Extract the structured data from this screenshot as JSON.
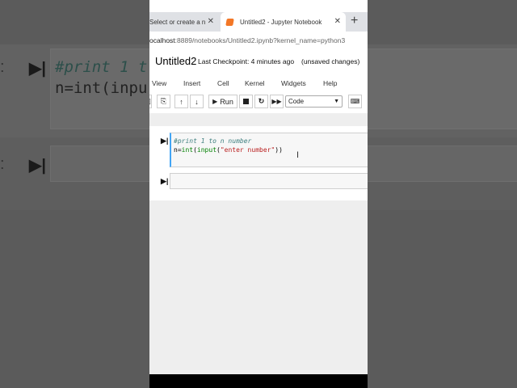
{
  "background": {
    "line1": "#print 1 t",
    "line2": "n=int(inpu",
    "colon": ":"
  },
  "tabs": {
    "inactive_label": "Select or create a n",
    "active_label": "Untitled2 - Jupyter Notebook",
    "new_tab": "+"
  },
  "address": {
    "host": "ocalhost",
    "rest": ":8889/notebooks/Untitled2.ipynb?kernel_name=python3"
  },
  "notebook": {
    "title": "Untitled2",
    "checkpoint": "Last Checkpoint: 4 minutes ago",
    "unsaved": "(unsaved changes)"
  },
  "menu": [
    "View",
    "Insert",
    "Cell",
    "Kernel",
    "Widgets",
    "Help"
  ],
  "toolbar": {
    "run_label": "Run",
    "cell_type": "Code"
  },
  "cells": [
    {
      "comment": "#print 1 to n number",
      "code_prefix": "n=",
      "code_int": "int",
      "code_paren": "(",
      "code_input": "input",
      "code_open": "(",
      "code_str": "\"enter number\"",
      "code_close": "))"
    }
  ],
  "colors": {
    "accent": "#42a5f5",
    "jupyter_orange": "#f37726"
  }
}
